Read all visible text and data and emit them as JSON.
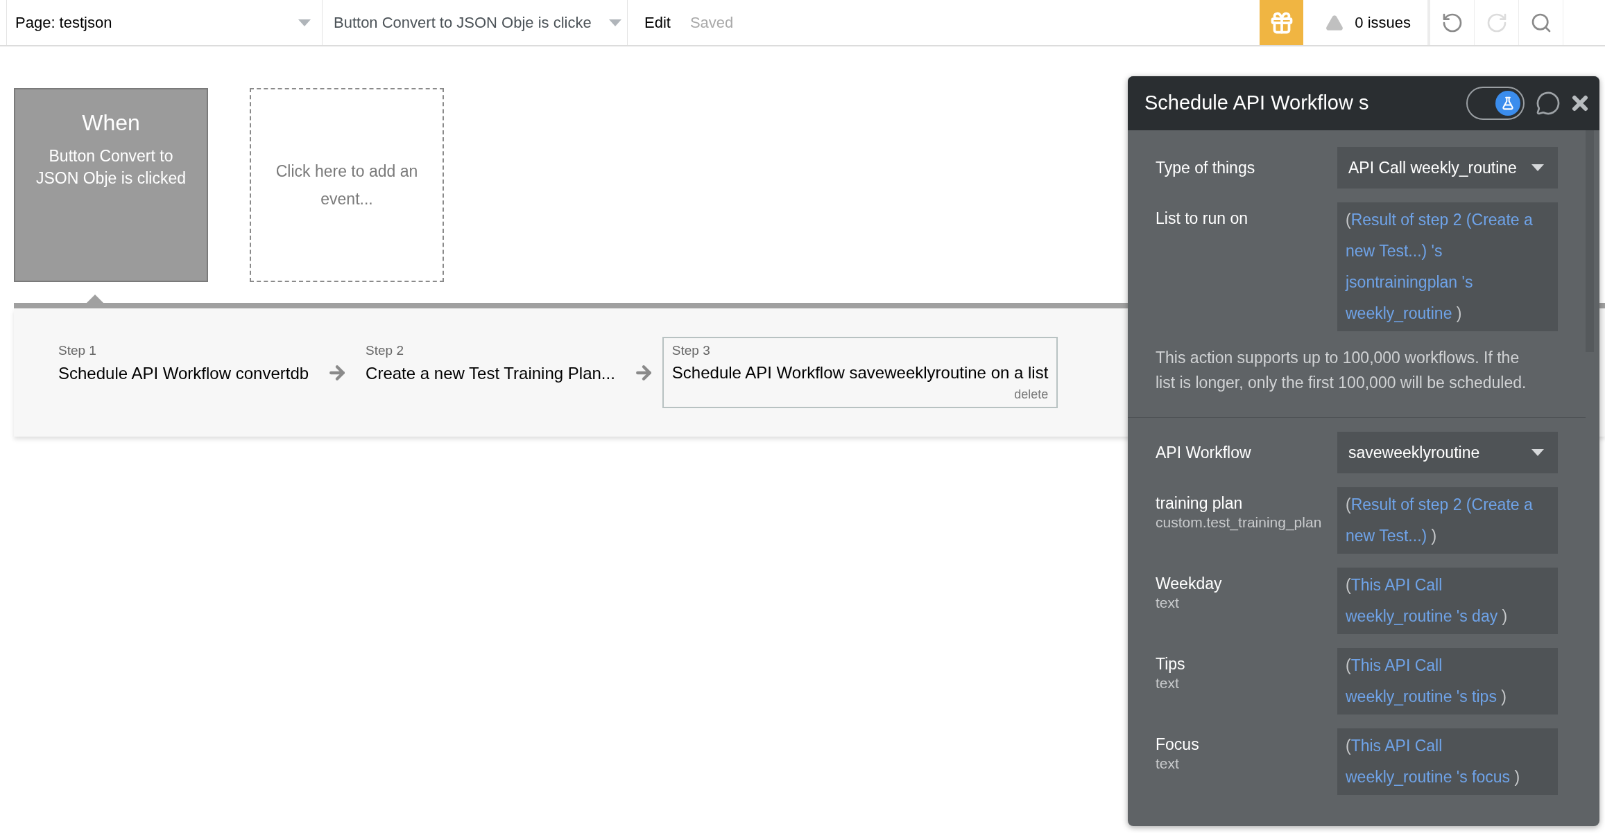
{
  "topbar": {
    "page_selector": "Page: testjson",
    "event_selector": "Button Convert to JSON Obje is clicke",
    "edit": "Edit",
    "save_status": "Saved",
    "issues": "0 issues",
    "undo_disabled": false,
    "redo_disabled": true
  },
  "events": [
    {
      "kind": "event",
      "title": "When",
      "text": "Button Convert to JSON Obje is clicked"
    },
    {
      "kind": "add",
      "text": "Click here to add an event..."
    }
  ],
  "steps": [
    {
      "label": "Step 1",
      "action": "Schedule API Workflow convertdb",
      "selected": false
    },
    {
      "label": "Step 2",
      "action": "Create a new Test Training Plan...",
      "selected": false
    },
    {
      "label": "Step 3",
      "action": "Schedule API Workflow saveweeklyroutine on a list",
      "selected": true,
      "delete": "delete"
    }
  ],
  "panel": {
    "title": "Schedule API Workflow s",
    "toggle_on": true,
    "fields": [
      {
        "kind": "dropdown",
        "label": "Type of things",
        "value": "API Call weekly_routine"
      },
      {
        "kind": "expression",
        "label": "List to run on",
        "open": "(",
        "value": "Result of step 2 (Create a new Test...) 's jsontrainingplan 's weekly_routine",
        "close": ")"
      },
      {
        "kind": "note",
        "text": "This action supports up to 100,000 workflows. If the list is longer, only the first 100,000 will be scheduled."
      },
      {
        "kind": "dropdown",
        "label": "API Workflow",
        "value": "saveweeklyroutine"
      },
      {
        "kind": "expression",
        "label": "training plan",
        "sublabel": "custom.test_training_plan",
        "open": "(",
        "value": "Result of step 2 (Create a new Test...)",
        "close": ")"
      },
      {
        "kind": "expression",
        "label": "Weekday",
        "sublabel": "text",
        "open": "(",
        "value": "This API Call weekly_routine 's day",
        "close": ")"
      },
      {
        "kind": "expression",
        "label": "Tips",
        "sublabel": "text",
        "open": "(",
        "value": "This API Call weekly_routine 's tips",
        "close": ")"
      },
      {
        "kind": "expression",
        "label": "Focus",
        "sublabel": "text",
        "open": "(",
        "value": "This API Call weekly_routine 's focus",
        "close": ")"
      }
    ]
  }
}
